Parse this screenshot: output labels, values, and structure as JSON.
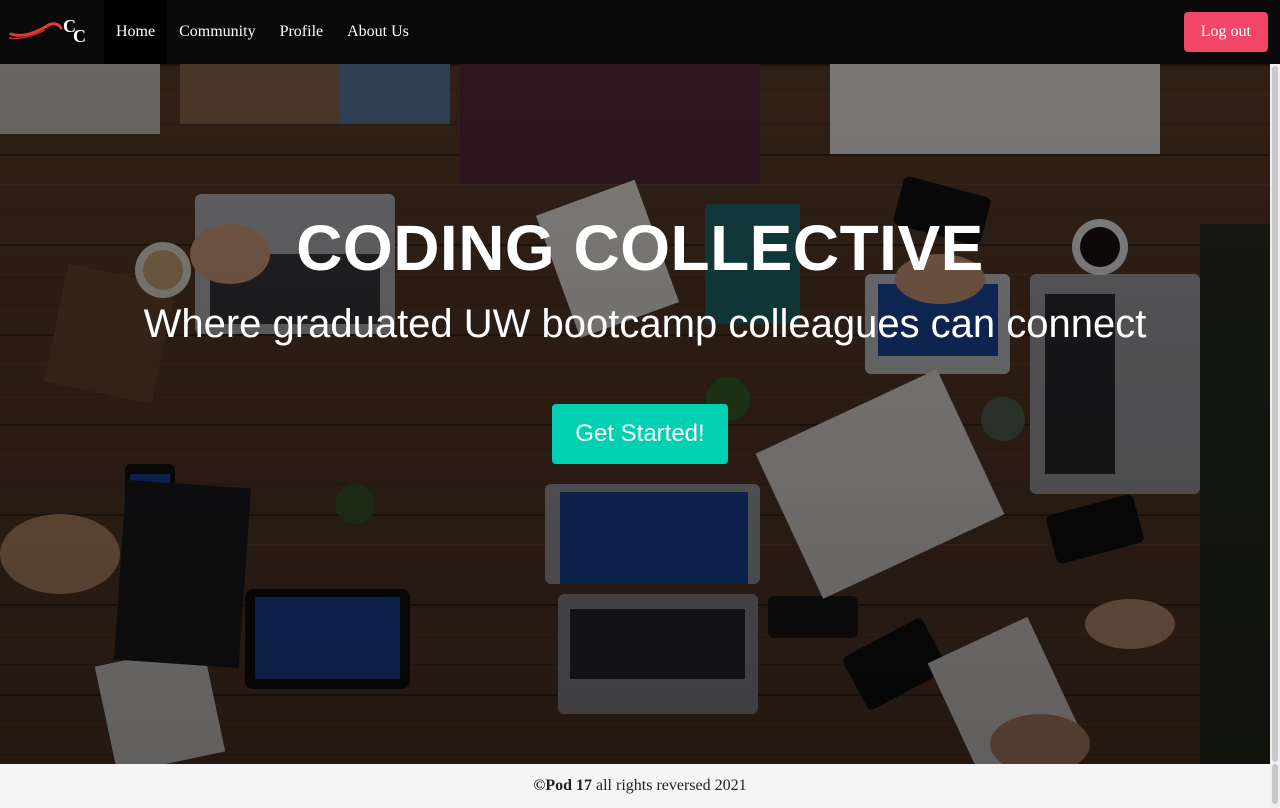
{
  "nav": {
    "brand_letters": "CC",
    "items": [
      {
        "label": "Home",
        "active": true
      },
      {
        "label": "Community",
        "active": false
      },
      {
        "label": "Profile",
        "active": false
      },
      {
        "label": "About Us",
        "active": false
      }
    ],
    "logout_label": "Log out"
  },
  "hero": {
    "title": "CODING COLLECTIVE",
    "subtitle": "Where graduated UW bootcamp colleagues can connect",
    "cta_label": "Get Started!"
  },
  "footer": {
    "owner": "©Pod 17",
    "text": " all rights reversed 2021"
  },
  "colors": {
    "navbar": "#0a0a0a",
    "logout": "#f14668",
    "cta": "#00d1b2",
    "footer": "#f5f5f5"
  }
}
